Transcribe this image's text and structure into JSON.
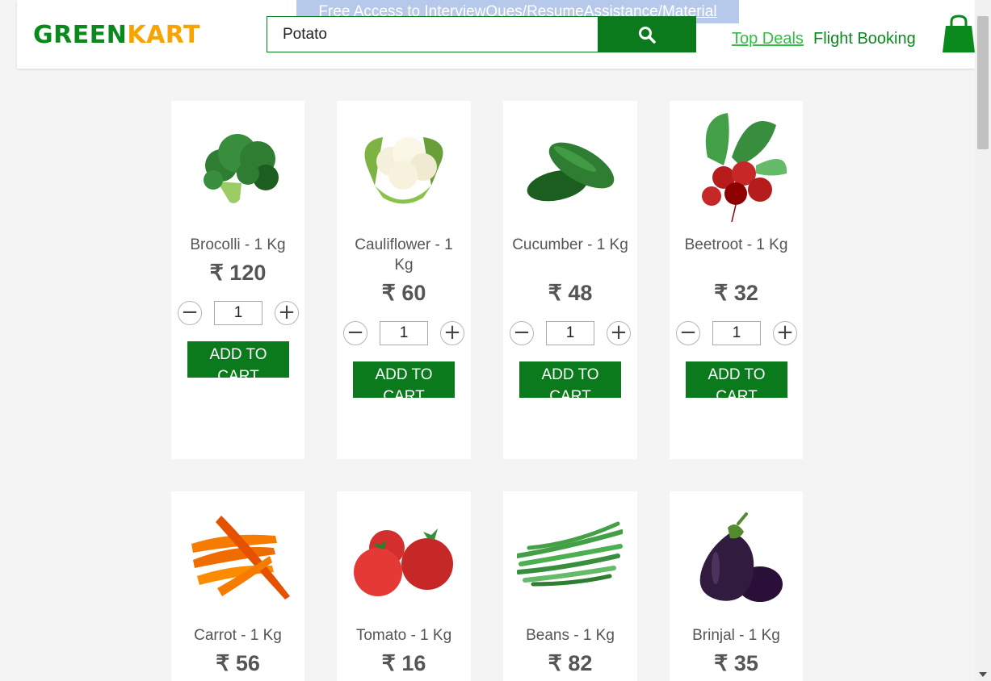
{
  "header": {
    "logo_part1": "GREEN",
    "logo_part2": "KART",
    "banner": "Free Access to InterviewQues/ResumeAssistance/Material",
    "search_value": "Potato",
    "nav_top_deals": "Top Deals",
    "nav_flight_booking": "Flight Booking"
  },
  "currency": "₹",
  "add_to_cart_label": "ADD TO CART",
  "products": [
    {
      "name": "Brocolli - 1 Kg",
      "price": "₹ 120",
      "qty": "1"
    },
    {
      "name": "Cauliflower - 1 Kg",
      "price": "₹ 60",
      "qty": "1"
    },
    {
      "name": "Cucumber - 1 Kg",
      "price": "₹ 48",
      "qty": "1"
    },
    {
      "name": "Beetroot - 1 Kg",
      "price": "₹ 32",
      "qty": "1"
    },
    {
      "name": "Carrot - 1 Kg",
      "price": "₹ 56"
    },
    {
      "name": "Tomato - 1 Kg",
      "price": "₹ 16"
    },
    {
      "name": "Beans - 1 Kg",
      "price": "₹ 82"
    },
    {
      "name": "Brinjal - 1 Kg",
      "price": "₹ 35"
    }
  ],
  "icons": {
    "search": "search-icon",
    "cart": "shopping-bag-icon",
    "minus": "minus-icon",
    "plus": "plus-icon"
  },
  "colors": {
    "brand_green": "#0a7a1d",
    "brand_orange": "#f7a400",
    "link_green": "#2ec040"
  }
}
